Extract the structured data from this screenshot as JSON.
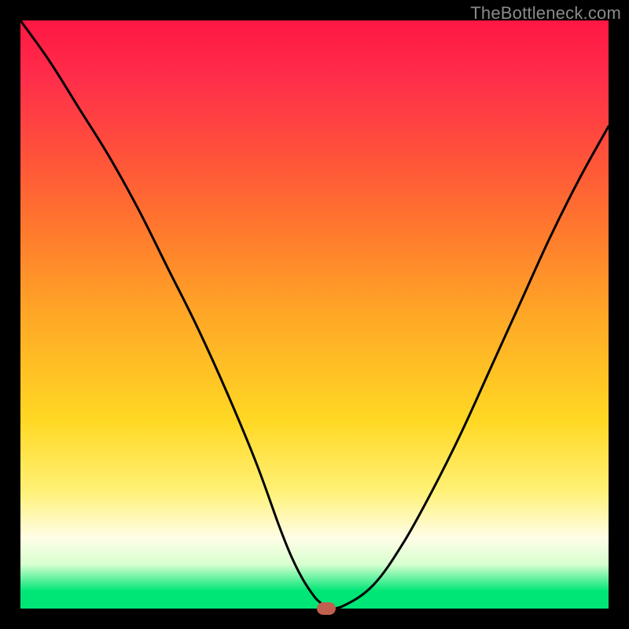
{
  "watermark": "TheBottleneck.com",
  "chart_data": {
    "type": "line",
    "title": "",
    "xlabel": "",
    "ylabel": "",
    "xlim": [
      0,
      100
    ],
    "ylim": [
      0,
      100
    ],
    "grid": false,
    "series": [
      {
        "name": "bottleneck-curve",
        "x": [
          0,
          5,
          10,
          15,
          20,
          25,
          30,
          35,
          40,
          44,
          46,
          48,
          50,
          51,
          51.5,
          52,
          55,
          60,
          65,
          70,
          75,
          80,
          85,
          90,
          95,
          100
        ],
        "values": [
          100,
          93,
          85,
          77,
          68,
          58,
          48,
          37,
          25,
          14,
          9,
          5,
          2,
          1,
          0.5,
          0,
          0.5,
          4,
          11,
          20,
          30,
          41,
          52,
          63,
          73,
          82
        ]
      }
    ],
    "marker": {
      "x": 52,
      "y": 0,
      "color": "#c0604f"
    },
    "background_gradient": {
      "type": "vertical",
      "stops": [
        {
          "pos": 0,
          "color": "#ff1744"
        },
        {
          "pos": 0.1,
          "color": "#ff2e4a"
        },
        {
          "pos": 0.24,
          "color": "#ff5539"
        },
        {
          "pos": 0.36,
          "color": "#ff7a2d"
        },
        {
          "pos": 0.5,
          "color": "#ffa726"
        },
        {
          "pos": 0.68,
          "color": "#ffd823"
        },
        {
          "pos": 0.8,
          "color": "#fff176"
        },
        {
          "pos": 0.88,
          "color": "#fffde7"
        },
        {
          "pos": 0.925,
          "color": "#d7ffcf"
        },
        {
          "pos": 0.97,
          "color": "#00e676"
        },
        {
          "pos": 1.0,
          "color": "#00e676"
        }
      ]
    }
  }
}
